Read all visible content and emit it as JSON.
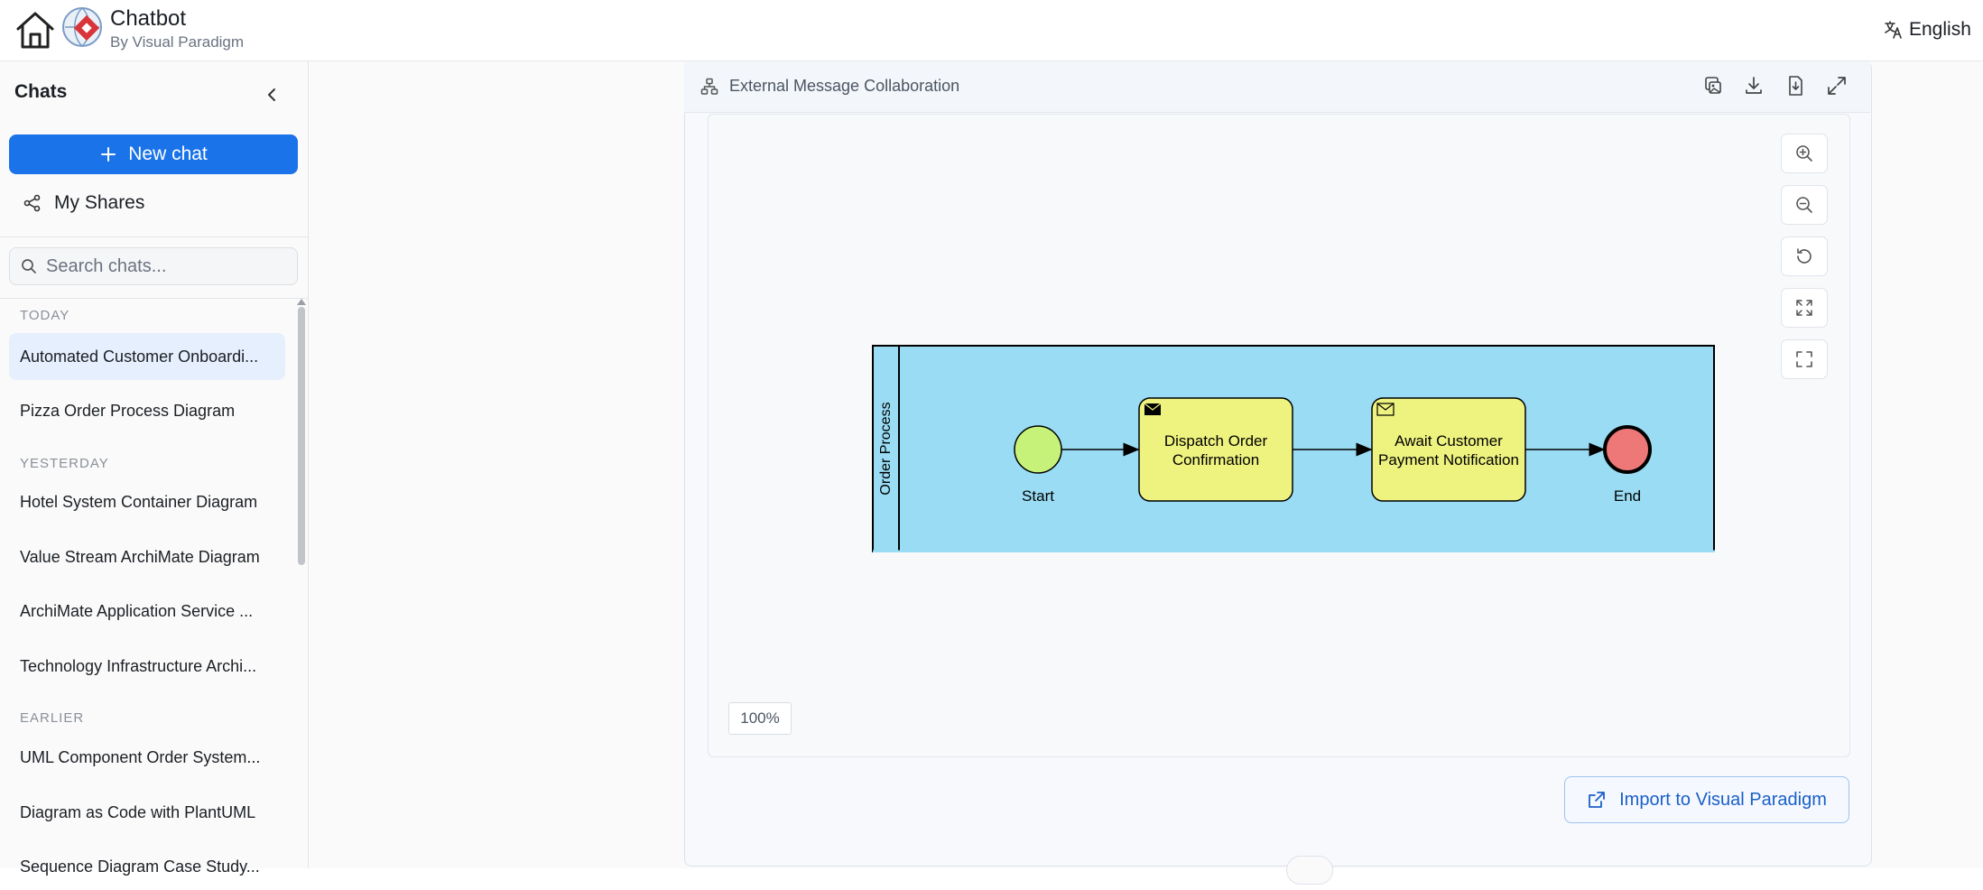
{
  "header": {
    "title": "Chatbot",
    "subtitle": "By Visual Paradigm",
    "language": "English"
  },
  "sidebar": {
    "title": "Chats",
    "new_chat_label": "New chat",
    "my_shares_label": "My Shares",
    "search_placeholder": "Search chats...",
    "groups": [
      {
        "label": "TODAY",
        "items": [
          "Automated Customer Onboardi...",
          "Pizza Order Process Diagram"
        ]
      },
      {
        "label": "YESTERDAY",
        "items": [
          "Hotel System Container Diagram",
          "Value Stream ArchiMate Diagram",
          "ArchiMate Application Service ...",
          "Technology Infrastructure Archi..."
        ]
      },
      {
        "label": "EARLIER",
        "items": [
          "UML Component Order System...",
          "Diagram as Code with PlantUML",
          "Sequence Diagram Case Study..."
        ]
      }
    ],
    "active_item": "Automated Customer Onboardi..."
  },
  "panel": {
    "title": "External Message Collaboration",
    "zoom_level": "100%",
    "import_label": "Import to Visual Paradigm"
  },
  "diagram": {
    "pool_label": "Order Process",
    "start_label": "Start",
    "task1_line1": "Dispatch Order",
    "task1_line2": "Confirmation",
    "task2_line1": "Await Customer",
    "task2_line2": "Payment Notification",
    "end_label": "End"
  },
  "colors": {
    "accent": "#1a73e8",
    "pool_fill": "#99dcf3",
    "task_fill": "#eef27f",
    "start_fill": "#c7f27a",
    "end_fill": "#ee7777"
  }
}
